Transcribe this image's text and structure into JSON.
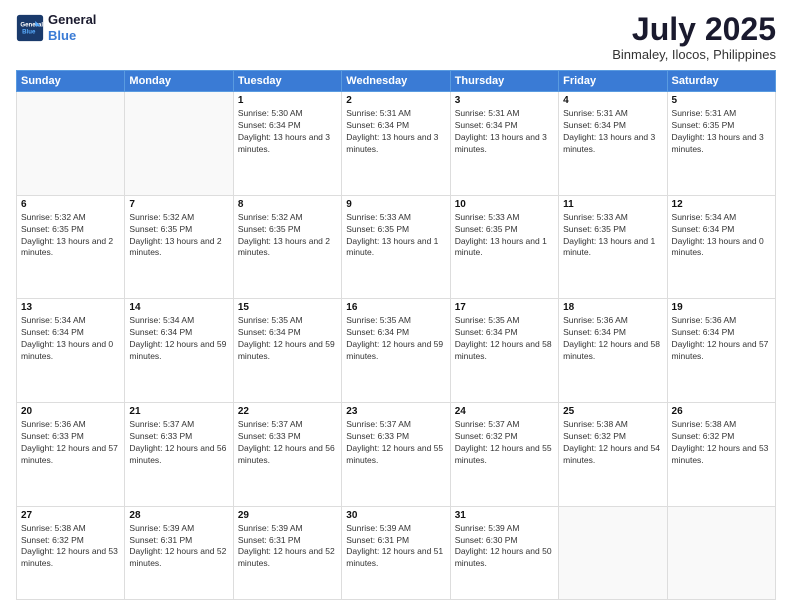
{
  "logo": {
    "line1": "General",
    "line2": "Blue"
  },
  "title": {
    "month_year": "July 2025",
    "location": "Binmaley, Ilocos, Philippines"
  },
  "weekdays": [
    "Sunday",
    "Monday",
    "Tuesday",
    "Wednesday",
    "Thursday",
    "Friday",
    "Saturday"
  ],
  "weeks": [
    [
      {
        "day": "",
        "sunrise": "",
        "sunset": "",
        "daylight": ""
      },
      {
        "day": "",
        "sunrise": "",
        "sunset": "",
        "daylight": ""
      },
      {
        "day": "1",
        "sunrise": "Sunrise: 5:30 AM",
        "sunset": "Sunset: 6:34 PM",
        "daylight": "Daylight: 13 hours and 3 minutes."
      },
      {
        "day": "2",
        "sunrise": "Sunrise: 5:31 AM",
        "sunset": "Sunset: 6:34 PM",
        "daylight": "Daylight: 13 hours and 3 minutes."
      },
      {
        "day": "3",
        "sunrise": "Sunrise: 5:31 AM",
        "sunset": "Sunset: 6:34 PM",
        "daylight": "Daylight: 13 hours and 3 minutes."
      },
      {
        "day": "4",
        "sunrise": "Sunrise: 5:31 AM",
        "sunset": "Sunset: 6:34 PM",
        "daylight": "Daylight: 13 hours and 3 minutes."
      },
      {
        "day": "5",
        "sunrise": "Sunrise: 5:31 AM",
        "sunset": "Sunset: 6:35 PM",
        "daylight": "Daylight: 13 hours and 3 minutes."
      }
    ],
    [
      {
        "day": "6",
        "sunrise": "Sunrise: 5:32 AM",
        "sunset": "Sunset: 6:35 PM",
        "daylight": "Daylight: 13 hours and 2 minutes."
      },
      {
        "day": "7",
        "sunrise": "Sunrise: 5:32 AM",
        "sunset": "Sunset: 6:35 PM",
        "daylight": "Daylight: 13 hours and 2 minutes."
      },
      {
        "day": "8",
        "sunrise": "Sunrise: 5:32 AM",
        "sunset": "Sunset: 6:35 PM",
        "daylight": "Daylight: 13 hours and 2 minutes."
      },
      {
        "day": "9",
        "sunrise": "Sunrise: 5:33 AM",
        "sunset": "Sunset: 6:35 PM",
        "daylight": "Daylight: 13 hours and 1 minute."
      },
      {
        "day": "10",
        "sunrise": "Sunrise: 5:33 AM",
        "sunset": "Sunset: 6:35 PM",
        "daylight": "Daylight: 13 hours and 1 minute."
      },
      {
        "day": "11",
        "sunrise": "Sunrise: 5:33 AM",
        "sunset": "Sunset: 6:35 PM",
        "daylight": "Daylight: 13 hours and 1 minute."
      },
      {
        "day": "12",
        "sunrise": "Sunrise: 5:34 AM",
        "sunset": "Sunset: 6:34 PM",
        "daylight": "Daylight: 13 hours and 0 minutes."
      }
    ],
    [
      {
        "day": "13",
        "sunrise": "Sunrise: 5:34 AM",
        "sunset": "Sunset: 6:34 PM",
        "daylight": "Daylight: 13 hours and 0 minutes."
      },
      {
        "day": "14",
        "sunrise": "Sunrise: 5:34 AM",
        "sunset": "Sunset: 6:34 PM",
        "daylight": "Daylight: 12 hours and 59 minutes."
      },
      {
        "day": "15",
        "sunrise": "Sunrise: 5:35 AM",
        "sunset": "Sunset: 6:34 PM",
        "daylight": "Daylight: 12 hours and 59 minutes."
      },
      {
        "day": "16",
        "sunrise": "Sunrise: 5:35 AM",
        "sunset": "Sunset: 6:34 PM",
        "daylight": "Daylight: 12 hours and 59 minutes."
      },
      {
        "day": "17",
        "sunrise": "Sunrise: 5:35 AM",
        "sunset": "Sunset: 6:34 PM",
        "daylight": "Daylight: 12 hours and 58 minutes."
      },
      {
        "day": "18",
        "sunrise": "Sunrise: 5:36 AM",
        "sunset": "Sunset: 6:34 PM",
        "daylight": "Daylight: 12 hours and 58 minutes."
      },
      {
        "day": "19",
        "sunrise": "Sunrise: 5:36 AM",
        "sunset": "Sunset: 6:34 PM",
        "daylight": "Daylight: 12 hours and 57 minutes."
      }
    ],
    [
      {
        "day": "20",
        "sunrise": "Sunrise: 5:36 AM",
        "sunset": "Sunset: 6:33 PM",
        "daylight": "Daylight: 12 hours and 57 minutes."
      },
      {
        "day": "21",
        "sunrise": "Sunrise: 5:37 AM",
        "sunset": "Sunset: 6:33 PM",
        "daylight": "Daylight: 12 hours and 56 minutes."
      },
      {
        "day": "22",
        "sunrise": "Sunrise: 5:37 AM",
        "sunset": "Sunset: 6:33 PM",
        "daylight": "Daylight: 12 hours and 56 minutes."
      },
      {
        "day": "23",
        "sunrise": "Sunrise: 5:37 AM",
        "sunset": "Sunset: 6:33 PM",
        "daylight": "Daylight: 12 hours and 55 minutes."
      },
      {
        "day": "24",
        "sunrise": "Sunrise: 5:37 AM",
        "sunset": "Sunset: 6:32 PM",
        "daylight": "Daylight: 12 hours and 55 minutes."
      },
      {
        "day": "25",
        "sunrise": "Sunrise: 5:38 AM",
        "sunset": "Sunset: 6:32 PM",
        "daylight": "Daylight: 12 hours and 54 minutes."
      },
      {
        "day": "26",
        "sunrise": "Sunrise: 5:38 AM",
        "sunset": "Sunset: 6:32 PM",
        "daylight": "Daylight: 12 hours and 53 minutes."
      }
    ],
    [
      {
        "day": "27",
        "sunrise": "Sunrise: 5:38 AM",
        "sunset": "Sunset: 6:32 PM",
        "daylight": "Daylight: 12 hours and 53 minutes."
      },
      {
        "day": "28",
        "sunrise": "Sunrise: 5:39 AM",
        "sunset": "Sunset: 6:31 PM",
        "daylight": "Daylight: 12 hours and 52 minutes."
      },
      {
        "day": "29",
        "sunrise": "Sunrise: 5:39 AM",
        "sunset": "Sunset: 6:31 PM",
        "daylight": "Daylight: 12 hours and 52 minutes."
      },
      {
        "day": "30",
        "sunrise": "Sunrise: 5:39 AM",
        "sunset": "Sunset: 6:31 PM",
        "daylight": "Daylight: 12 hours and 51 minutes."
      },
      {
        "day": "31",
        "sunrise": "Sunrise: 5:39 AM",
        "sunset": "Sunset: 6:30 PM",
        "daylight": "Daylight: 12 hours and 50 minutes."
      },
      {
        "day": "",
        "sunrise": "",
        "sunset": "",
        "daylight": ""
      },
      {
        "day": "",
        "sunrise": "",
        "sunset": "",
        "daylight": ""
      }
    ]
  ]
}
